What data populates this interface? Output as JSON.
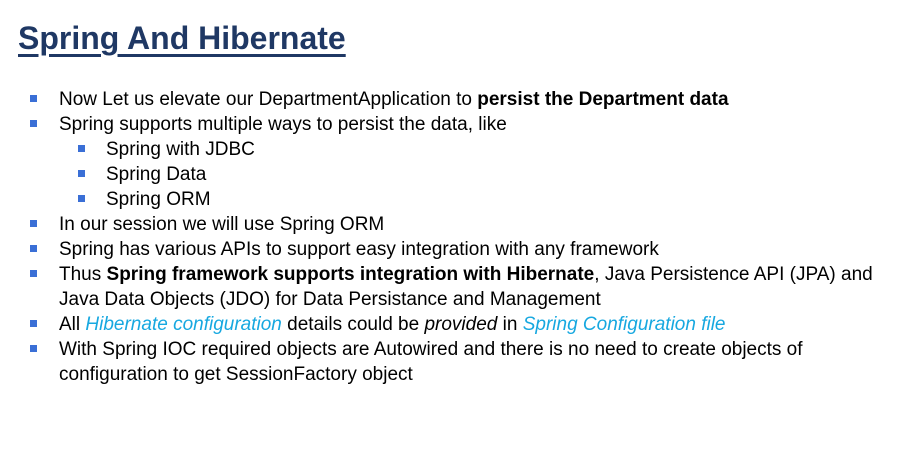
{
  "slide": {
    "title": "Spring And Hibernate",
    "accent_color": "#1f3864",
    "bullet_color": "#3a6fd6",
    "link_color": "#17a8e0",
    "bullets": [
      {
        "level": 1,
        "segments": [
          {
            "text": "Now Let us elevate our DepartmentApplication to ",
            "style": "normal"
          },
          {
            "text": "persist the Department data",
            "style": "bold"
          }
        ]
      },
      {
        "level": 1,
        "segments": [
          {
            "text": "Spring supports multiple ways to persist the data, like",
            "style": "normal"
          }
        ]
      },
      {
        "level": 2,
        "segments": [
          {
            "text": "Spring with JDBC",
            "style": "normal"
          }
        ]
      },
      {
        "level": 2,
        "segments": [
          {
            "text": "Spring Data",
            "style": "normal"
          }
        ]
      },
      {
        "level": 2,
        "segments": [
          {
            "text": "Spring ORM",
            "style": "normal"
          }
        ]
      },
      {
        "level": 1,
        "segments": [
          {
            "text": "In our session we will use Spring ORM",
            "style": "normal"
          }
        ]
      },
      {
        "level": 1,
        "segments": [
          {
            "text": "Spring has various APIs to support easy integration with any framework",
            "style": "normal"
          }
        ]
      },
      {
        "level": 1,
        "segments": [
          {
            "text": "Thus ",
            "style": "normal"
          },
          {
            "text": "Spring framework supports integration with Hibernate",
            "style": "bold"
          },
          {
            "text": ", Java Persistence API (JPA) and Java Data Objects (JDO) for Data Persistance and Management",
            "style": "normal"
          }
        ]
      },
      {
        "level": 1,
        "segments": [
          {
            "text": "All ",
            "style": "normal"
          },
          {
            "text": "Hibernate configuration",
            "style": "link"
          },
          {
            "text": " details could be ",
            "style": "normal"
          },
          {
            "text": "provided",
            "style": "italic"
          },
          {
            "text": " in ",
            "style": "normal"
          },
          {
            "text": "Spring Configuration file",
            "style": "link"
          }
        ]
      },
      {
        "level": 1,
        "segments": [
          {
            "text": "With Spring IOC required objects are Autowired and there is no need to create objects of configuration to get SessionFactory object",
            "style": "normal"
          }
        ]
      }
    ]
  }
}
